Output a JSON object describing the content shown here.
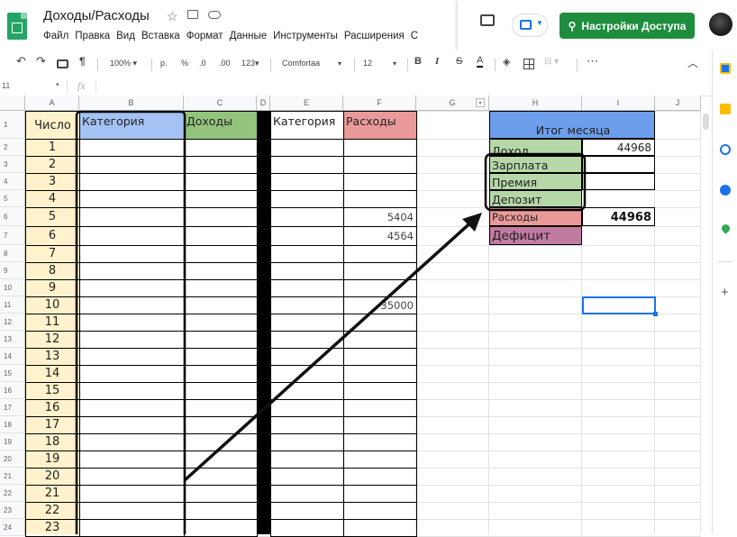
{
  "app": {
    "doc_title": "Доходы/Расходы",
    "menu": [
      "Файл",
      "Правка",
      "Вид",
      "Вставка",
      "Формат",
      "Данные",
      "Инструменты",
      "Расширения",
      "С"
    ],
    "share_label": "Настройки Доступа"
  },
  "toolbar": {
    "zoom": "100%",
    "currency": "р.",
    "percent": "%",
    "dec_less": ".0",
    "dec_more": ".00",
    "format_123": "123",
    "font": "Comfortaa",
    "font_size": "12",
    "bold": "B",
    "italic": "I",
    "strike": "S",
    "text_color": "A",
    "more": "⋯"
  },
  "formula_bar": {
    "cell_ref": "11",
    "fx": "fx"
  },
  "columns": [
    "A",
    "B",
    "C",
    "D",
    "E",
    "F",
    "G",
    "H",
    "I",
    "J"
  ],
  "rows": [
    "1",
    "2",
    "3",
    "4",
    "5",
    "6",
    "7",
    "8",
    "9",
    "10",
    "11",
    "12",
    "13",
    "14",
    "15",
    "16",
    "17",
    "18",
    "19",
    "20",
    "21",
    "22",
    "23",
    "24"
  ],
  "headers": {
    "a1": "Число",
    "b1": "Категория",
    "c1": "Доходы",
    "e1": "Категория",
    "f1": "Расходы"
  },
  "numbers": [
    "1",
    "2",
    "3",
    "4",
    "5",
    "6",
    "7",
    "8",
    "9",
    "10",
    "11",
    "12",
    "13",
    "14",
    "15",
    "16",
    "17",
    "18",
    "19",
    "20",
    "21",
    "22",
    "23"
  ],
  "expenses": {
    "f6": "5404",
    "f7": "4564",
    "f11": "35000"
  },
  "summary": {
    "title": "Итог месяца",
    "income_label": "Доход",
    "income_value": "44968",
    "salary_label": "Зарплата",
    "bonus_label": "Премия",
    "deposit_label": "Депозит",
    "expenses_label": "Расходы",
    "expenses_value": "44968",
    "deficit_label": "Дефицит"
  },
  "colors": {
    "number_col": "#fff2cc",
    "category_hdr": "#a4c2f4",
    "income_hdr": "#93c47d",
    "expense_hdr": "#ea9999",
    "summary_title": "#6d9eeb",
    "income_green": "#b6d7a8",
    "expense_red": "#ea9999",
    "deficit_purple": "#c27ba0",
    "share_green": "#1e8e3e"
  }
}
